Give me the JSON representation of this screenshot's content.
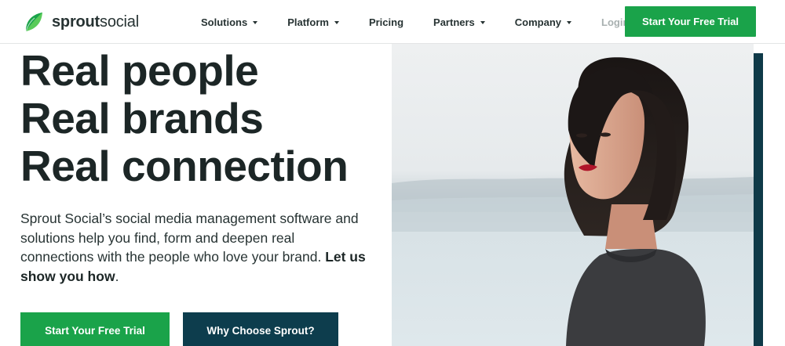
{
  "brand": {
    "name_bold": "sprout",
    "name_light": "social",
    "green": "#1aa34a",
    "dark_teal": "#0d3d4d"
  },
  "nav": {
    "items": [
      {
        "label": "Solutions",
        "has_dropdown": true
      },
      {
        "label": "Platform",
        "has_dropdown": true
      },
      {
        "label": "Pricing",
        "has_dropdown": false
      },
      {
        "label": "Partners",
        "has_dropdown": true
      },
      {
        "label": "Company",
        "has_dropdown": true
      },
      {
        "label": "Login",
        "has_dropdown": true
      }
    ],
    "cta": "Start Your Free Trial"
  },
  "hero": {
    "headline": [
      "Real people",
      "Real brands",
      "Real connection"
    ],
    "description": "Sprout Social’s social media management software and solutions help you find, form and deepen real connections with the people who love your brand.",
    "description_bold": "Let us show you how",
    "description_end": ".",
    "primary_button": "Start Your Free Trial",
    "secondary_button": "Why Choose Sprout?"
  },
  "image": {
    "subject": "woman-portrait-photo"
  }
}
